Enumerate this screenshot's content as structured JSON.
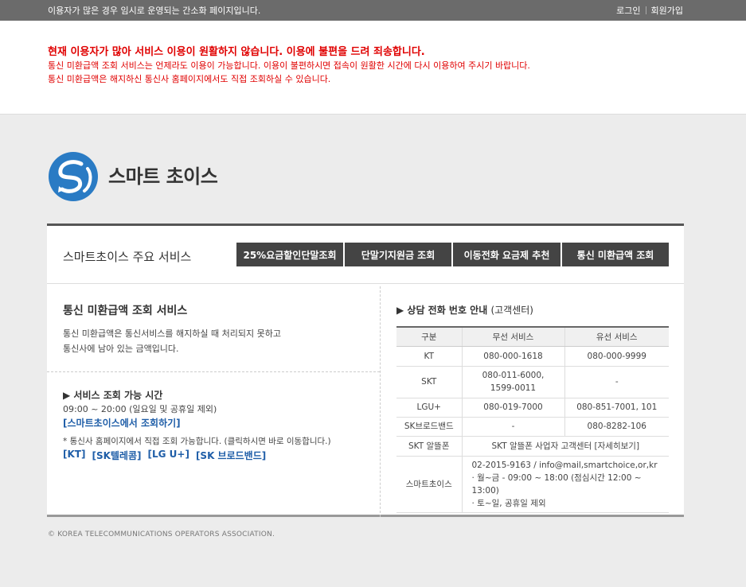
{
  "topbar": {
    "notice": "이용자가 많은 경우 임시로 운영되는 간소화 페이지입니다.",
    "login": "로그인",
    "signup": "회원가입"
  },
  "notice": {
    "line1": "현재 이용자가 많아 서비스 이용이 원활하지 않습니다. 이용에 불편을 드려 죄송합니다.",
    "line2": "통신 미환급액 조회 서비스는 언제라도 이용이 가능합니다. 이용이 불편하시면 접속이 원활한 시간에 다시 이용하여 주시기 바랍니다.",
    "line3": "통신 미환급액은 해지하신 통신사 홈페이지에서도 직접 조회하실 수 있습니다."
  },
  "logo": {
    "text": "스마트 초이스"
  },
  "services": {
    "title": "스마트초이스 주요 서비스",
    "buttons": [
      "25%요금할인단말조회",
      "단말기지원금 조회",
      "이동전화 요금제 추천",
      "통신 미환급액 조회"
    ]
  },
  "refund": {
    "title": "통신 미환급액 조회 서비스",
    "desc1": "통신 미환급액은 통신서비스를 해지하실 때 처리되지 못하고",
    "desc2": "통신사에 남아 있는 금액입니다.",
    "hours_title": "▶ 서비스 조회 가능 시간",
    "hours": "09:00 ~ 20:00 (일요일 및 공휴일 제외)",
    "smartchoice_link": "[스마트초이스에서 조회하기]",
    "carrier_note": "* 통신사 홈페이지에서 직접 조회 가능합니다. (클릭하시면 바로 이동합니다.)",
    "carriers": [
      "[KT]",
      "[SK텔레콤]",
      "[LG U+]",
      "[SK 브로드밴드]"
    ]
  },
  "contact": {
    "title": "▶ 상담 전화 번호 안내 ",
    "subtitle": "(고객센터)",
    "headers": [
      "구분",
      "무선 서비스",
      "유선 서비스"
    ],
    "rows": [
      {
        "name": "KT",
        "wireless": "080-000-1618",
        "wired": "080-000-9999"
      },
      {
        "name": "SKT",
        "wireless": "080-011-6000,",
        "wireless2": "1599-0011",
        "wired": "-"
      },
      {
        "name": "LGU+",
        "wireless": "080-019-7000",
        "wired": "080-851-7001, 101"
      },
      {
        "name": "SK브로드밴드",
        "wireless": "-",
        "wired": "080-8282-106"
      },
      {
        "name": "SKT 알뜰폰",
        "merged": "SKT 알뜰폰 사업자 고객센터 [자세히보기]"
      },
      {
        "name": "스마트초이스",
        "l1": "02-2015-9163 / info@mail,smartchoice,or,kr",
        "l2": "· 월~금 - 09:00 ~ 18:00 (점심시간 12:00 ~ 13:00)",
        "l3": "· 토~일, 공휴일 제외"
      }
    ]
  },
  "footer": {
    "copyright": "© KOREA TELECOMMUNICATIONS OPERATORS ASSOCIATION."
  },
  "colors": {
    "accent_red": "#e00000",
    "link_blue": "#1f5ea8",
    "logo_blue": "#2a7bc4",
    "button_dark": "#444444"
  }
}
